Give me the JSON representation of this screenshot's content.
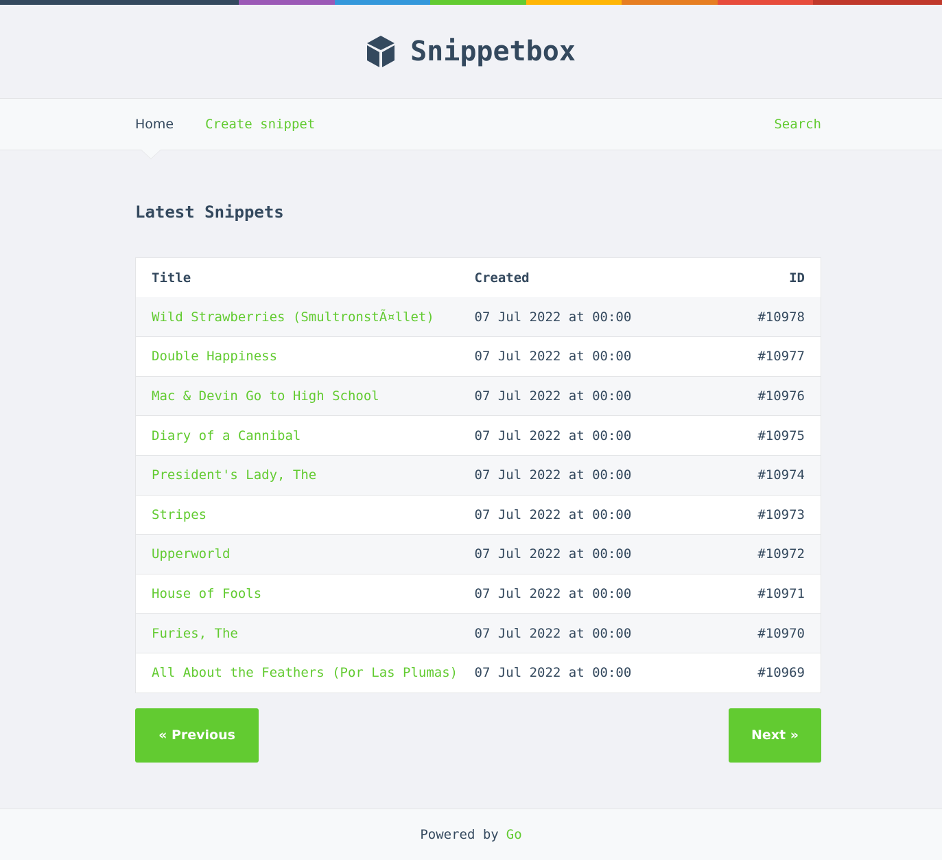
{
  "app": {
    "title": "Snippetbox",
    "accent_color": "#62cb31",
    "text_color": "#34495e"
  },
  "nav": {
    "home_label": "Home",
    "create_label": "Create snippet",
    "search_label": "Search"
  },
  "main": {
    "heading": "Latest Snippets",
    "table": {
      "headers": {
        "title": "Title",
        "created": "Created",
        "id": "ID"
      },
      "rows": [
        {
          "title": "Wild Strawberries (SmultronstÃ¤llet)",
          "created": "07 Jul 2022 at 00:00",
          "id": "#10978"
        },
        {
          "title": "Double Happiness",
          "created": "07 Jul 2022 at 00:00",
          "id": "#10977"
        },
        {
          "title": "Mac & Devin Go to High School",
          "created": "07 Jul 2022 at 00:00",
          "id": "#10976"
        },
        {
          "title": "Diary of a Cannibal",
          "created": "07 Jul 2022 at 00:00",
          "id": "#10975"
        },
        {
          "title": "President's Lady, The",
          "created": "07 Jul 2022 at 00:00",
          "id": "#10974"
        },
        {
          "title": "Stripes",
          "created": "07 Jul 2022 at 00:00",
          "id": "#10973"
        },
        {
          "title": "Upperworld",
          "created": "07 Jul 2022 at 00:00",
          "id": "#10972"
        },
        {
          "title": "House of Fools",
          "created": "07 Jul 2022 at 00:00",
          "id": "#10971"
        },
        {
          "title": "Furies, The",
          "created": "07 Jul 2022 at 00:00",
          "id": "#10970"
        },
        {
          "title": "All About the Feathers (Por Las Plumas)",
          "created": "07 Jul 2022 at 00:00",
          "id": "#10969"
        }
      ]
    },
    "pagination": {
      "previous_label": "« Previous",
      "next_label": "Next »"
    }
  },
  "footer": {
    "powered_by": "Powered by",
    "go_label": "Go"
  },
  "icons": {
    "logo": "cube-icon"
  }
}
